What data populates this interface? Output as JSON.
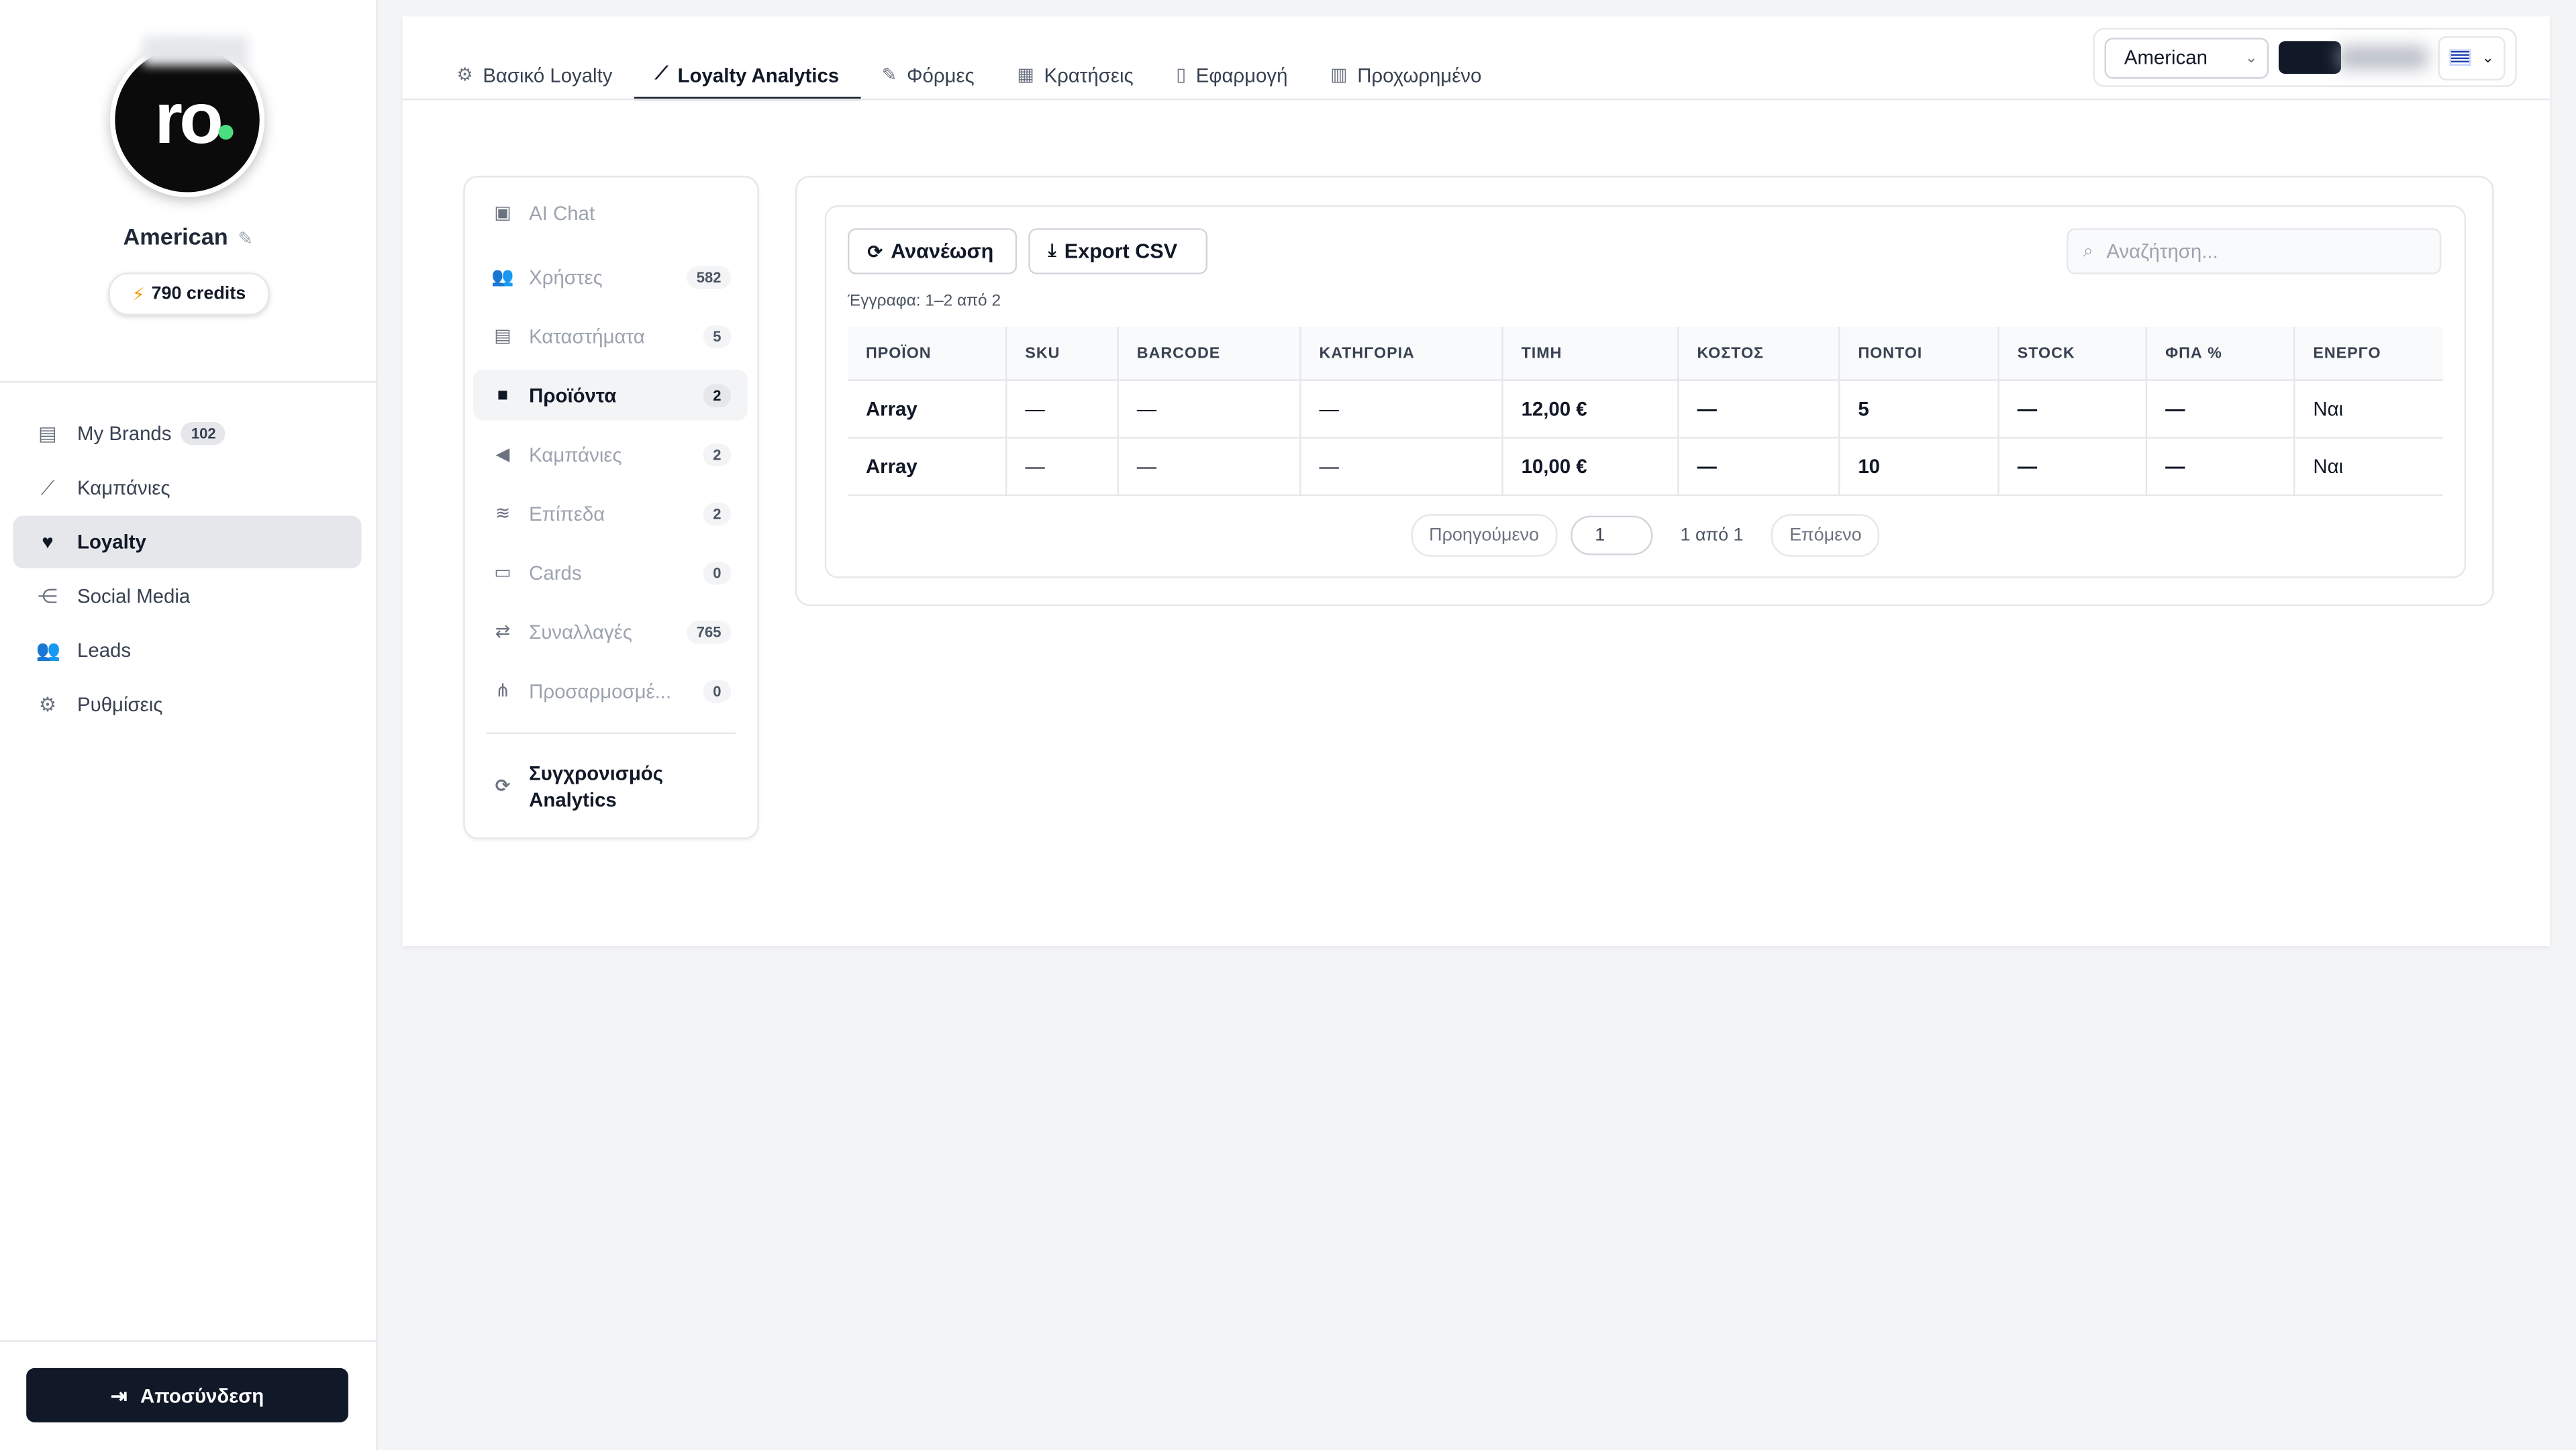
{
  "sidebar": {
    "avatar_text": "ro",
    "brand_name": "American",
    "credits": "790 credits",
    "nav": [
      {
        "label": "My Brands",
        "badge": "102",
        "icon": "store-icon"
      },
      {
        "label": "Καμπάνιες",
        "icon": "chart-line-icon"
      },
      {
        "label": "Loyalty",
        "icon": "heart-icon",
        "active": true
      },
      {
        "label": "Social Media",
        "icon": "share-icon"
      },
      {
        "label": "Leads",
        "icon": "users-icon"
      },
      {
        "label": "Ρυθμίσεις",
        "icon": "gear-icon"
      }
    ],
    "logout_label": "Αποσύνδεση"
  },
  "tabs": [
    {
      "label": "Βασικό Loyalty",
      "icon": "cogs-icon"
    },
    {
      "label": "Loyalty Analytics",
      "icon": "chart-line-icon",
      "active": true
    },
    {
      "label": "Φόρμες",
      "icon": "edit-icon"
    },
    {
      "label": "Κρατήσεις",
      "icon": "calendar-icon"
    },
    {
      "label": "Εφαρμογή",
      "icon": "mobile-icon"
    },
    {
      "label": "Προχωρημένο",
      "icon": "building-icon"
    }
  ],
  "header": {
    "brand_select_value": "American"
  },
  "subnav": {
    "items": [
      {
        "label": "AI Chat",
        "icon": "robot-icon"
      },
      {
        "label": "Χρήστες",
        "count": "582",
        "icon": "users-icon"
      },
      {
        "label": "Καταστήματα",
        "count": "5",
        "icon": "store-icon"
      },
      {
        "label": "Προϊόντα",
        "count": "2",
        "icon": "bag-icon",
        "active": true
      },
      {
        "label": "Καμπάνιες",
        "count": "2",
        "icon": "megaphone-icon"
      },
      {
        "label": "Επίπεδα",
        "count": "2",
        "icon": "layers-icon"
      },
      {
        "label": "Cards",
        "count": "0",
        "icon": "id-card-icon"
      },
      {
        "label": "Συναλλαγές",
        "count": "765",
        "icon": "exchange-icon"
      },
      {
        "label": "Προσαρμοσμέ...",
        "count": "0",
        "icon": "diagram-icon"
      }
    ],
    "sync_label_1": "Συγχρονισμός",
    "sync_label_2": "Analytics"
  },
  "toolbar": {
    "refresh_label": "Ανανέωση",
    "export_label": "Export CSV",
    "search_placeholder": "Αναζήτηση...",
    "records_info": "Έγγραφα: 1–2 από 2"
  },
  "table": {
    "columns": [
      "ΠΡΟΪΟΝ",
      "SKU",
      "BARCODE",
      "ΚΑΤΗΓΟΡΙΑ",
      "ΤΙΜΗ",
      "ΚΟΣΤΟΣ",
      "ΠΟΝΤΟΙ",
      "STOCK",
      "ΦΠΑ %",
      "ΕΝΕΡΓΟ"
    ],
    "rows": [
      [
        "Array",
        "—",
        "—",
        "—",
        "12,00 €",
        "—",
        "5",
        "—",
        "—",
        "Ναι"
      ],
      [
        "Array",
        "—",
        "—",
        "—",
        "10,00 €",
        "—",
        "10",
        "—",
        "—",
        "Ναι"
      ]
    ]
  },
  "pager": {
    "prev": "Προηγούμενο",
    "page_value": "1",
    "info": "1 από 1",
    "next": "Επόμενο"
  }
}
